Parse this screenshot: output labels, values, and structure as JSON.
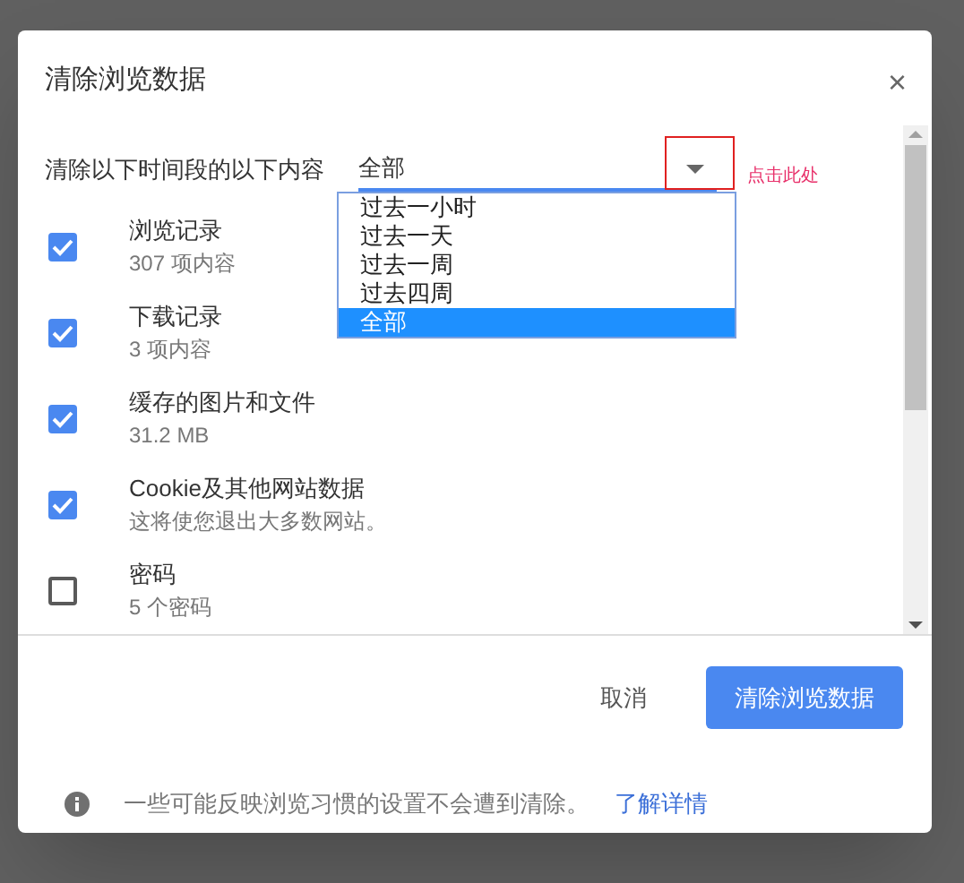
{
  "dialog": {
    "title": "清除浏览数据",
    "close": "×",
    "time_range": {
      "label": "清除以下时间段的以下内容",
      "value": "全部",
      "expanded": true,
      "options": [
        {
          "label": "过去一小时",
          "selected": false
        },
        {
          "label": "过去一天",
          "selected": false
        },
        {
          "label": "过去一周",
          "selected": false
        },
        {
          "label": "过去四周",
          "selected": false
        },
        {
          "label": "全部",
          "selected": true
        }
      ]
    },
    "annotation": {
      "text": "点击此处"
    },
    "items": [
      {
        "label": "浏览记录",
        "detail": "307 项内容",
        "checked": true
      },
      {
        "label": "下载记录",
        "detail": "3 项内容",
        "checked": true
      },
      {
        "label": "缓存的图片和文件",
        "detail": "31.2 MB",
        "checked": true
      },
      {
        "label": "Cookie及其他网站数据",
        "detail": "这将使您退出大多数网站。",
        "checked": true
      },
      {
        "label": "密码",
        "detail": "5 个密码",
        "checked": false
      }
    ],
    "buttons": {
      "cancel": "取消",
      "confirm": "清除浏览数据"
    },
    "footer": {
      "text": "一些可能反映浏览习惯的设置不会遭到清除。",
      "link": "了解详情"
    }
  }
}
